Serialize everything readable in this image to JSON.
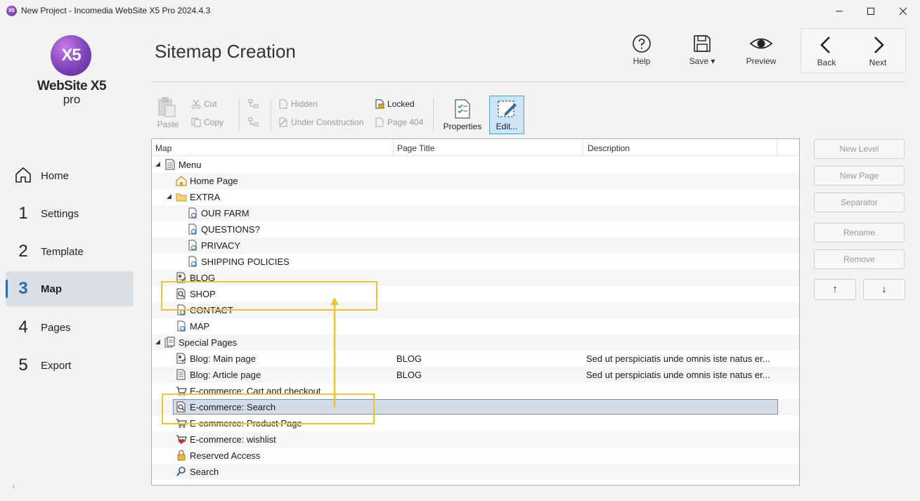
{
  "window": {
    "app_icon": "X5",
    "title": "New Project - Incomedia WebSite X5 Pro 2024.4.3",
    "buttons": [
      "minimize-icon",
      "maximize-icon",
      "close-icon"
    ]
  },
  "logo": {
    "badge": "X5",
    "name": "WebSite X5",
    "edition": "pro"
  },
  "nav": [
    {
      "num": "",
      "label": "Home",
      "icon": "home-icon"
    },
    {
      "num": "1",
      "label": "Settings"
    },
    {
      "num": "2",
      "label": "Template"
    },
    {
      "num": "3",
      "label": "Map",
      "active": true
    },
    {
      "num": "4",
      "label": "Pages"
    },
    {
      "num": "5",
      "label": "Export"
    }
  ],
  "collapse": "‹",
  "header": {
    "title": "Sitemap Creation"
  },
  "top_tools": {
    "help": "Help",
    "save": "Save",
    "preview": "Preview",
    "back": "Back",
    "next": "Next"
  },
  "toolbar": {
    "paste": "Paste",
    "cut": "Cut",
    "copy": "Copy",
    "hidden": "Hidden",
    "under_construction": "Under Construction",
    "locked": "Locked",
    "page404": "Page 404",
    "properties": "Properties",
    "edit": "Edit..."
  },
  "tree": {
    "columns": [
      "Map",
      "Page Title",
      "Description"
    ],
    "rows": [
      {
        "level": 0,
        "expander": "◢",
        "icon": "menu-icon",
        "label": "Menu"
      },
      {
        "level": 1,
        "icon": "home-page-icon",
        "label": "Home Page"
      },
      {
        "level": 1,
        "expander": "◢",
        "icon": "folder-icon",
        "label": "EXTRA"
      },
      {
        "level": 2,
        "icon": "page-icon",
        "label": "OUR FARM"
      },
      {
        "level": 2,
        "icon": "page-icon",
        "label": "QUESTIONS?"
      },
      {
        "level": 2,
        "icon": "page-icon",
        "label": "PRIVACY"
      },
      {
        "level": 2,
        "icon": "page-icon",
        "label": "SHIPPING POLICIES"
      },
      {
        "level": 1,
        "icon": "blog-page-icon",
        "label": "BLOG"
      },
      {
        "level": 1,
        "icon": "search-page-icon",
        "label": "SHOP"
      },
      {
        "level": 1,
        "icon": "page-icon",
        "label": "CONTACT"
      },
      {
        "level": 1,
        "icon": "page-icon",
        "label": "MAP"
      },
      {
        "level": 0,
        "expander": "◢",
        "icon": "special-pages-icon",
        "label": "Special Pages"
      },
      {
        "level": 1,
        "icon": "blog-page-icon",
        "label": "Blog: Main page",
        "page_title": "BLOG",
        "description": "Sed ut perspiciatis unde omnis iste natus er..."
      },
      {
        "level": 1,
        "icon": "blog-article-icon",
        "label": "Blog: Article page",
        "page_title": "BLOG",
        "description": "Sed ut perspiciatis unde omnis iste natus er..."
      },
      {
        "level": 1,
        "icon": "cart-icon",
        "label": "E-commerce: Cart and checkout"
      },
      {
        "level": 1,
        "icon": "search-page-icon",
        "label": "E-commerce: Search",
        "selected": true
      },
      {
        "level": 1,
        "icon": "cart-icon",
        "label": "E-commerce: Product Page"
      },
      {
        "level": 1,
        "icon": "wishlist-icon",
        "label": "E-commerce: wishlist"
      },
      {
        "level": 1,
        "icon": "lock-icon",
        "label": "Reserved Access"
      },
      {
        "level": 1,
        "icon": "search-icon",
        "label": "Search"
      }
    ]
  },
  "side_buttons": {
    "new_level": "New Level",
    "new_page": "New Page",
    "separator": "Separator",
    "rename": "Rename",
    "remove": "Remove",
    "up": "↑",
    "down": "↓"
  },
  "annotation_color": "#f0c52a"
}
